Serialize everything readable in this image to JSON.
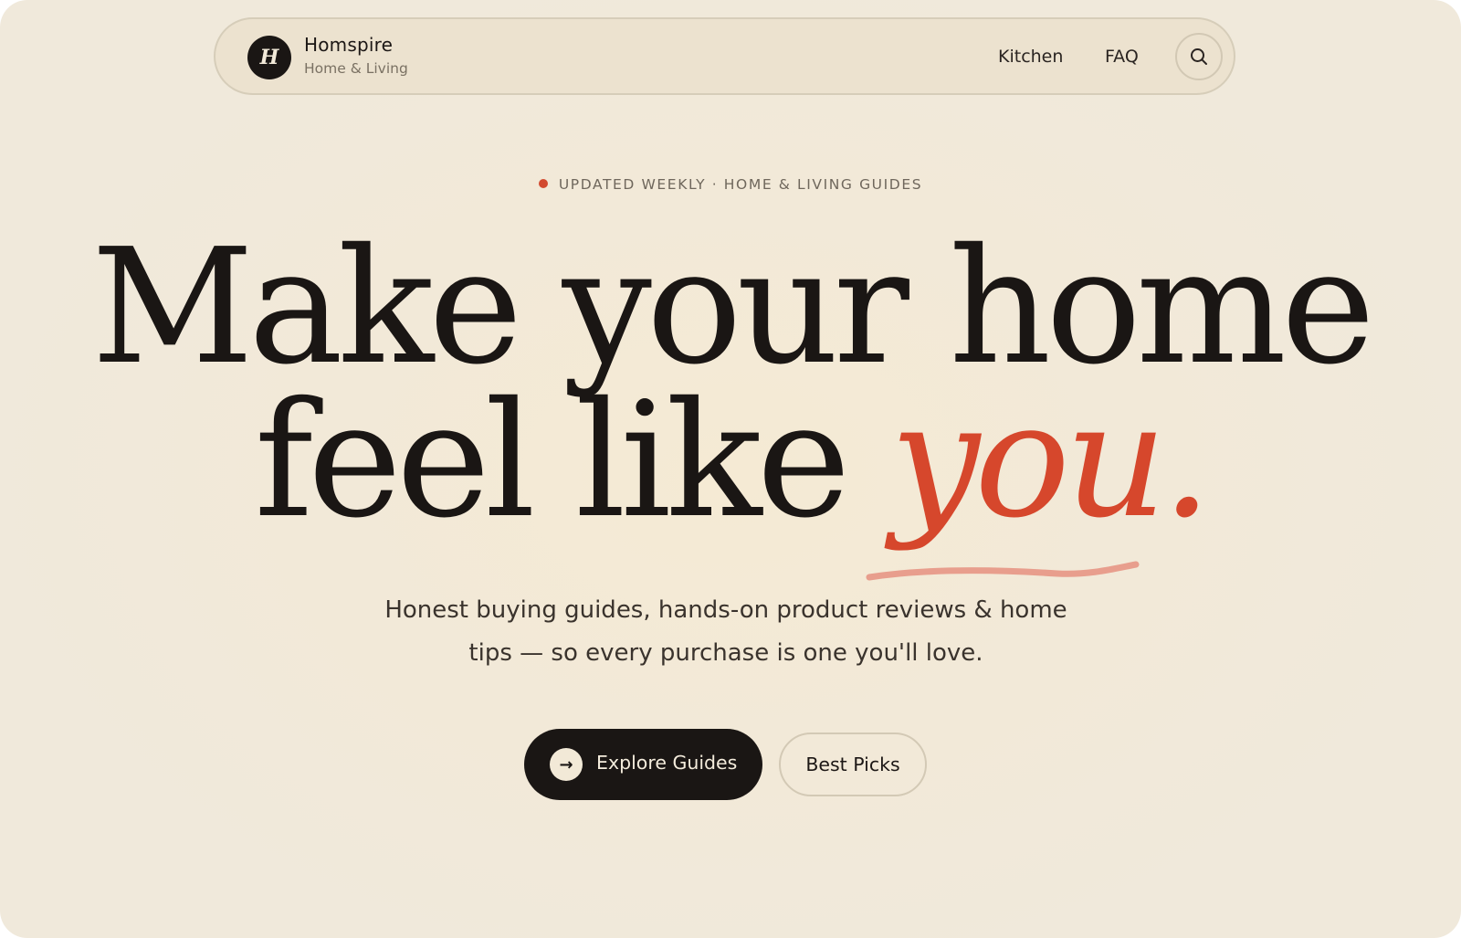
{
  "nav": {
    "logo_letter": "H",
    "brand_name": "Homspire",
    "brand_tagline": "Home & Living",
    "links": [
      {
        "label": "Kitchen"
      },
      {
        "label": "FAQ"
      }
    ],
    "search_icon": "search-icon"
  },
  "hero": {
    "eyebrow": "UPDATED WEEKLY · HOME & LIVING GUIDES",
    "headline_line1": "Make your home",
    "headline_line2_plain": "feel like ",
    "headline_line2_accent": "you.",
    "subtitle": "Honest buying guides, hands-on product reviews & home tips — so every purchase is one you'll love.",
    "primary_cta": {
      "label": "Explore Guides",
      "icon": "arrow-right-icon"
    },
    "secondary_cta": {
      "label": "Best Picks"
    }
  },
  "colors": {
    "background": "#f2e9d8",
    "ink": "#1a1614",
    "accent": "#d6472c",
    "accent_soft": "#e89e8d"
  }
}
